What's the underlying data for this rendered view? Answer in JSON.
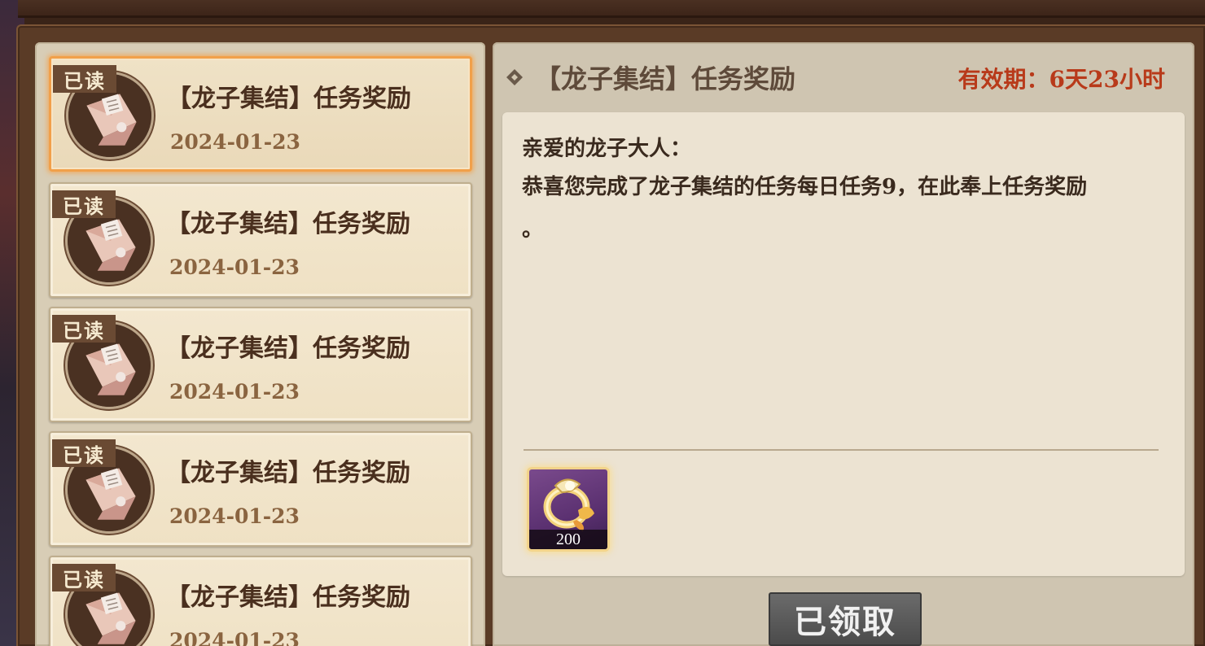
{
  "mail_list": {
    "items": [
      {
        "tag": "已读",
        "title": "【龙子集结】任务奖励",
        "date": "2024-01-23",
        "selected": true
      },
      {
        "tag": "已读",
        "title": "【龙子集结】任务奖励",
        "date": "2024-01-23",
        "selected": false
      },
      {
        "tag": "已读",
        "title": "【龙子集结】任务奖励",
        "date": "2024-01-23",
        "selected": false
      },
      {
        "tag": "已读",
        "title": "【龙子集结】任务奖励",
        "date": "2024-01-23",
        "selected": false
      },
      {
        "tag": "已读",
        "title": "【龙子集结】任务奖励",
        "date": "2024-01-23",
        "selected": false
      }
    ],
    "icon": "envelope-icon"
  },
  "detail": {
    "icon": "diamond-icon",
    "title": "【龙子集结】任务奖励",
    "expiry": "有效期：6天23小时",
    "greeting": "亲爱的龙子大人：",
    "body": "恭喜您完成了龙子集结的任务每日任务9，在此奉上任务奖励",
    "body_tail": "。",
    "reward": {
      "icon": "golden-ring-icon",
      "count": "200"
    },
    "claimed_label": "已领取"
  },
  "colors": {
    "selected_border": "#f1a04a",
    "expiry_text": "#b83a1a",
    "read_tag_bg": "#6a4a33"
  }
}
